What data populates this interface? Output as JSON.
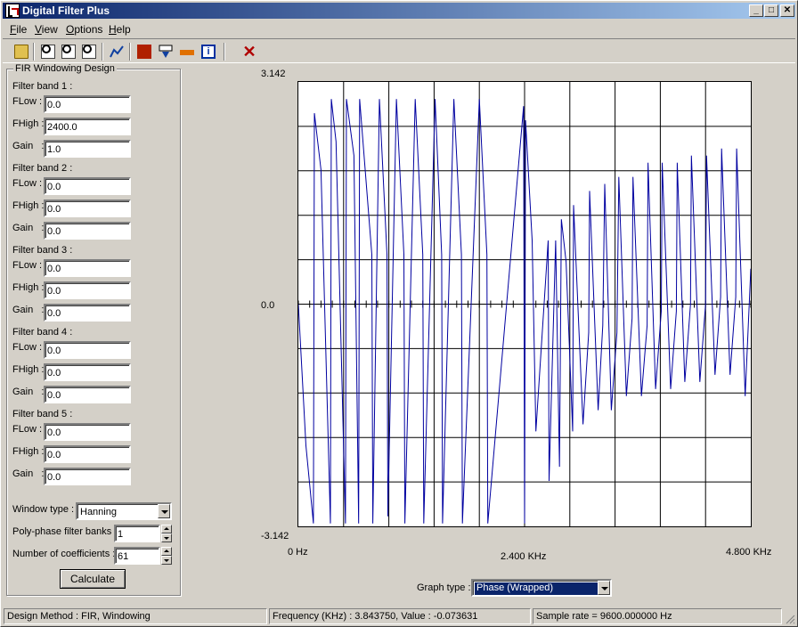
{
  "window": {
    "title": "Digital Filter Plus",
    "minimize_label": "_",
    "maximize_label": "□",
    "close_label": "✕"
  },
  "menu": [
    {
      "label": "File",
      "key": "F",
      "rest": "ile"
    },
    {
      "label": "View",
      "key": "V",
      "rest": "iew"
    },
    {
      "label": "Options",
      "key": "O",
      "rest": "ptions"
    },
    {
      "label": "Help",
      "key": "H",
      "rest": "elp"
    }
  ],
  "toolbar": {
    "icons": [
      "open-folder-icon",
      "zoom-icon",
      "zoom-in-icon",
      "zoom-out-icon",
      "graph-plot-icon",
      "question-icon",
      "filter-export-icon",
      "tool-icon",
      "info-icon",
      "close-graph-icon"
    ],
    "info_glyph": "i",
    "close_glyph": "✕"
  },
  "design": {
    "group_title": "FIR Windowing Design",
    "bands": [
      {
        "title": "Filter band 1 :",
        "flow_label": "FLow :",
        "flow": "0.0",
        "fhigh_label": "FHigh :",
        "fhigh": "2400.0",
        "gain_label": "Gain   :",
        "gain": "1.0"
      },
      {
        "title": "Filter band 2 :",
        "flow_label": "FLow :",
        "flow": "0.0",
        "fhigh_label": "FHigh :",
        "fhigh": "0.0",
        "gain_label": "Gain   :",
        "gain": "0.0"
      },
      {
        "title": "Filter band 3 :",
        "flow_label": "FLow :",
        "flow": "0.0",
        "fhigh_label": "FHigh :",
        "fhigh": "0.0",
        "gain_label": "Gain   :",
        "gain": "0.0"
      },
      {
        "title": "Filter band 4 :",
        "flow_label": "FLow :",
        "flow": "0.0",
        "fhigh_label": "FHigh :",
        "fhigh": "0.0",
        "gain_label": "Gain   :",
        "gain": "0.0"
      },
      {
        "title": "Filter band 5 :",
        "flow_label": "FLow :",
        "flow": "0.0",
        "fhigh_label": "FHigh :",
        "fhigh": "0.0",
        "gain_label": "Gain   :",
        "gain": "0.0"
      }
    ],
    "window_type_label": "Window type :",
    "window_type": "Hanning",
    "polyphase_label": "Poly-phase filter banks :",
    "polyphase": "1",
    "coeffs_label": "Number of coefficients :",
    "coeffs": "61",
    "calculate_label": "Calculate"
  },
  "graph": {
    "y_max_label": "3.142",
    "y_mid_label": "0.0",
    "y_min_label": "-3.142",
    "x_min_label": "0 Hz",
    "x_mid_label": "2.400 KHz",
    "x_max_label": "4.800 KHz",
    "graph_type_label": "Graph type :",
    "graph_type": "Phase (Wrapped)",
    "line_color": "#0000a0"
  },
  "chart_data": {
    "type": "line",
    "title": "",
    "xlabel": "",
    "ylabel": "",
    "xlim": [
      0,
      4800
    ],
    "ylim": [
      -3.142,
      3.142
    ],
    "x_ticks": [
      "0 Hz",
      "2.400 KHz",
      "4.800 KHz"
    ],
    "y_ticks": [
      "3.142",
      "0.0",
      "-3.142"
    ],
    "grid": true,
    "series": [
      {
        "x": [
          0,
          80,
          160,
          170,
          240,
          340,
          350,
          400,
          500,
          510,
          590,
          640,
          650,
          780,
          790,
          860,
          940,
          950,
          1040,
          1120,
          1130,
          1240,
          1320,
          1330,
          1450,
          1520,
          1530,
          1650,
          1730,
          1740,
          1920,
          2000,
          2010,
          2390,
          2400,
          2410,
          2480,
          2520,
          2650,
          2660,
          2730,
          2770,
          2790,
          2840,
          2910,
          2920,
          3020,
          3080,
          3090,
          3180,
          3230,
          3250,
          3320,
          3380,
          3400,
          3480,
          3540,
          3550,
          3640,
          3700,
          3710,
          3790,
          3850,
          3860,
          3950,
          4010,
          4020,
          4100,
          4160,
          4170,
          4260,
          4320,
          4330,
          4420,
          4480,
          4490,
          4580,
          4640,
          4650,
          4740,
          4800
        ],
        "y": [
          0,
          -2.0,
          -3.1,
          2.7,
          1.9,
          -3.1,
          2.9,
          2.3,
          -3.1,
          2.9,
          2.1,
          -3.1,
          2.9,
          0.7,
          -3.1,
          2.9,
          0.7,
          -3.0,
          2.9,
          0.7,
          -3.1,
          2.9,
          0.7,
          -3.1,
          2.9,
          0.7,
          -3.1,
          2.9,
          0.7,
          -3.1,
          2.9,
          0.7,
          -3.1,
          2.8,
          -3.1,
          2.6,
          0.9,
          -1.8,
          0.9,
          -2.5,
          0.9,
          -2.3,
          1.2,
          0.6,
          -1.8,
          1.4,
          -1.7,
          -0.4,
          1.6,
          -1.5,
          -0.3,
          1.7,
          -1.5,
          -0.4,
          1.8,
          -1.3,
          -0.2,
          1.8,
          -1.3,
          -0.3,
          2.0,
          -1.2,
          -0.1,
          2.0,
          -1.2,
          -0.1,
          2.0,
          -1.1,
          0.0,
          2.1,
          -1.1,
          0.0,
          2.1,
          -1.0,
          0.1,
          2.2,
          -1.0,
          0.1,
          2.2,
          -1.3,
          0.5
        ]
      }
    ]
  },
  "status": {
    "method": "Design Method : FIR, Windowing",
    "readout": "Frequency (KHz) : 3.843750, Value : -0.073631",
    "sample_rate": "Sample rate = 9600.000000 Hz"
  }
}
